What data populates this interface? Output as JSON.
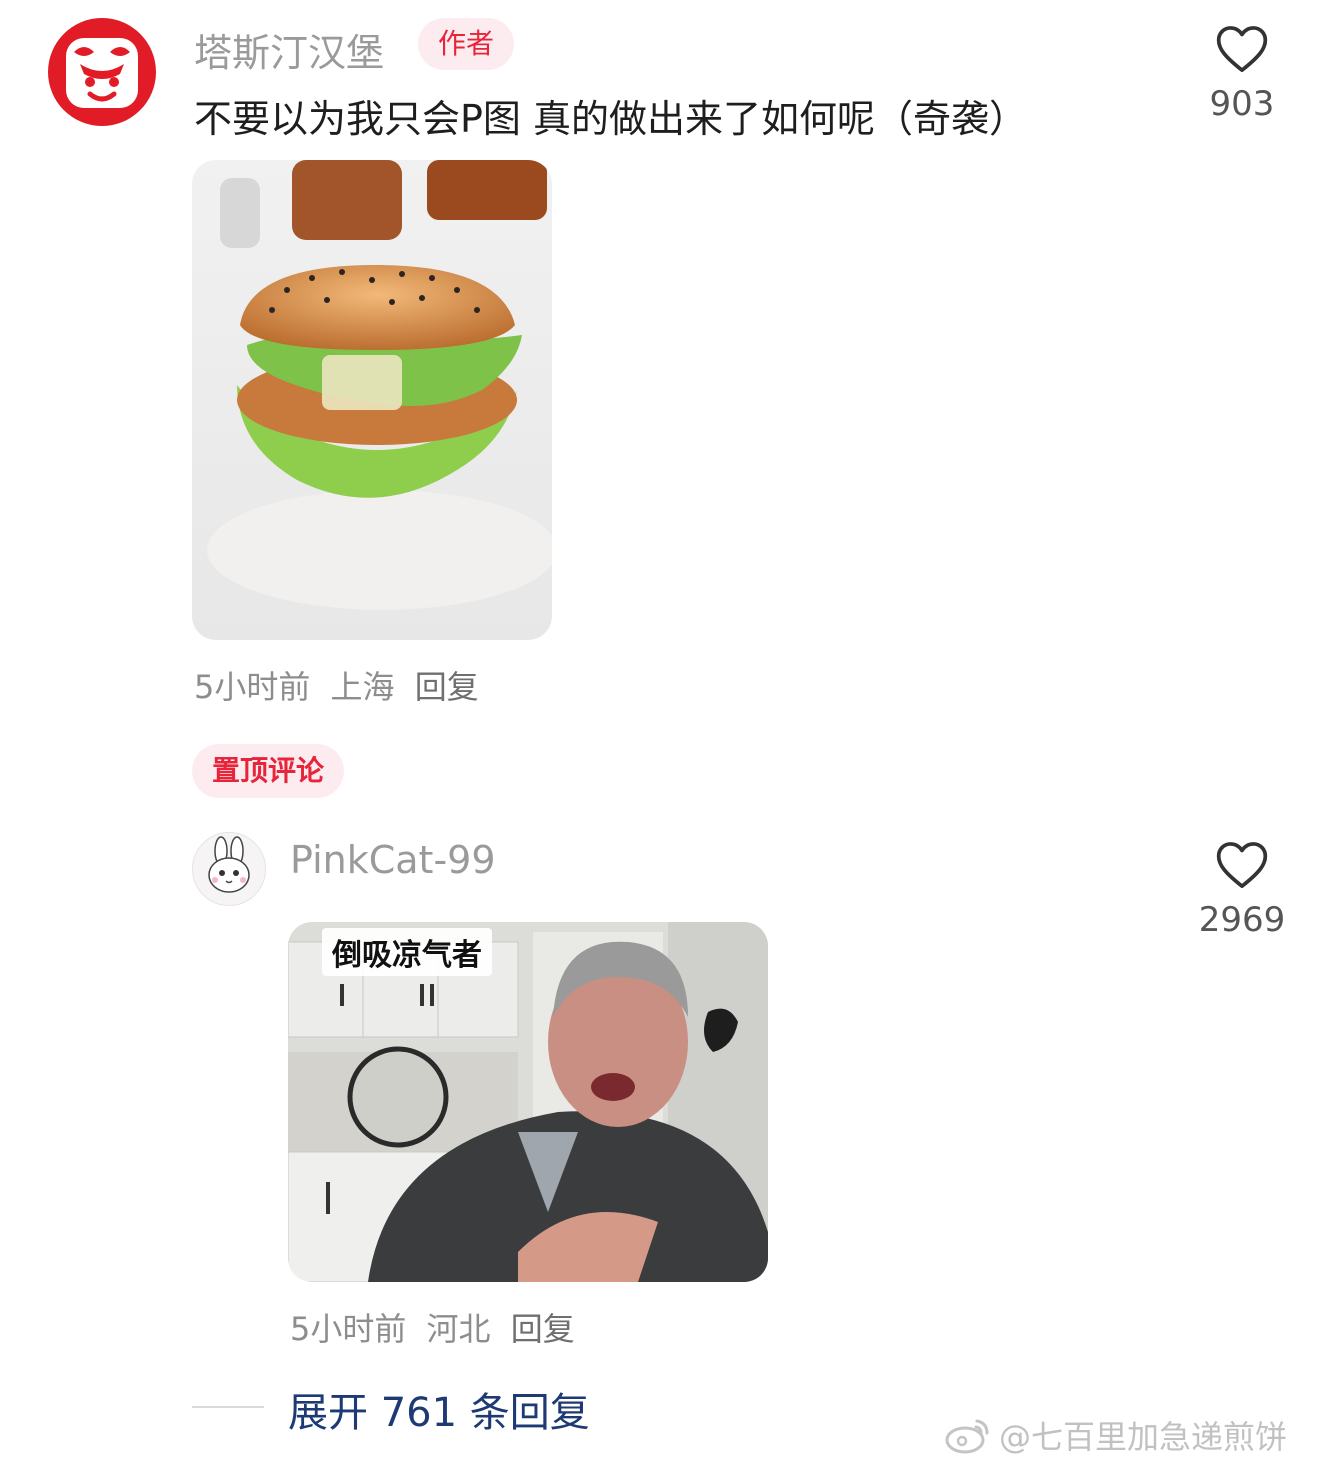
{
  "author_comment": {
    "username": "塔斯汀汉堡",
    "badge": "作者",
    "text": "不要以为我只会P图 真的做出来了如何呢（奇袭）",
    "time": "5小时前",
    "location": "上海",
    "reply_label": "回复",
    "likes": "903"
  },
  "pinned_label": "置顶评论",
  "reply_comment": {
    "username": "PinkCat-99",
    "image_caption": "倒吸凉气者",
    "time": "5小时前",
    "location": "河北",
    "reply_label": "回复",
    "likes": "2969"
  },
  "expand_replies": "展开 761 条回复",
  "watermark": "@七百里加急递煎饼",
  "colors": {
    "brand_red": "#e11c26",
    "badge_red": "#e8243a",
    "link_blue": "#1d3a75"
  },
  "icons": [
    "heart-icon",
    "weibo-icon"
  ]
}
